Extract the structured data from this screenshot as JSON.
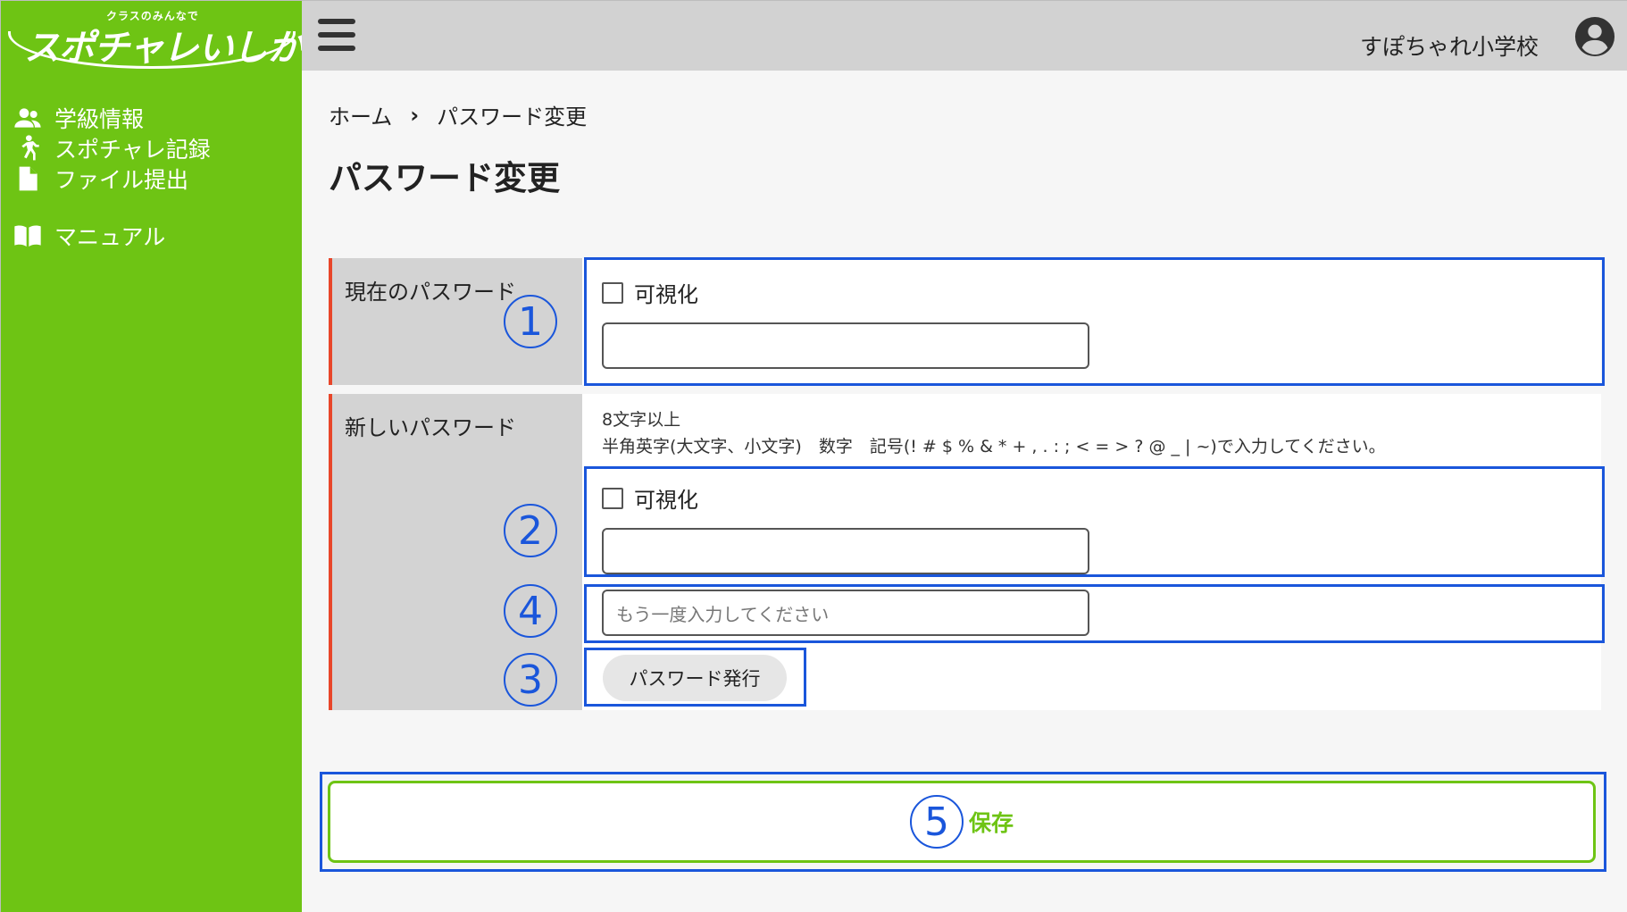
{
  "logo": {
    "sub": "クラスのみんなで",
    "main": "スポチャレいしかわ"
  },
  "sidebar": {
    "items": [
      {
        "label": "学級情報",
        "icon": "users-icon"
      },
      {
        "label": "スポチャレ記録",
        "icon": "runner-icon"
      },
      {
        "label": "ファイル提出",
        "icon": "file-icon"
      },
      {
        "label": "マニュアル",
        "icon": "book-icon"
      }
    ]
  },
  "header": {
    "school_name": "すぽちゃれ小学校"
  },
  "breadcrumb": {
    "home": "ホーム",
    "separator": "›",
    "current": "パスワード変更"
  },
  "page": {
    "title": "パスワード変更"
  },
  "form": {
    "current_password": {
      "label": "現在のパスワード",
      "visibility_label": "可視化",
      "value": ""
    },
    "new_password": {
      "label": "新しいパスワード",
      "hint_line1": "8文字以上",
      "hint_line2": "半角英字(大文字、小文字)　数字　記号(! # $ % & * + , . : ; < = > ? @ _ | ~)で入力してください。",
      "visibility_label": "可視化",
      "value": "",
      "confirm_placeholder": "もう一度入力してください",
      "generate_label": "パスワード発行"
    },
    "save_label": "保存"
  },
  "annotations": [
    "1",
    "2",
    "4",
    "3",
    "5"
  ],
  "colors": {
    "sidebar": "#6ec414",
    "header": "#d2d2d2",
    "accent_left_border": "#e8462a",
    "annotation_blue": "#1a56db",
    "save_green": "#6ec414"
  }
}
